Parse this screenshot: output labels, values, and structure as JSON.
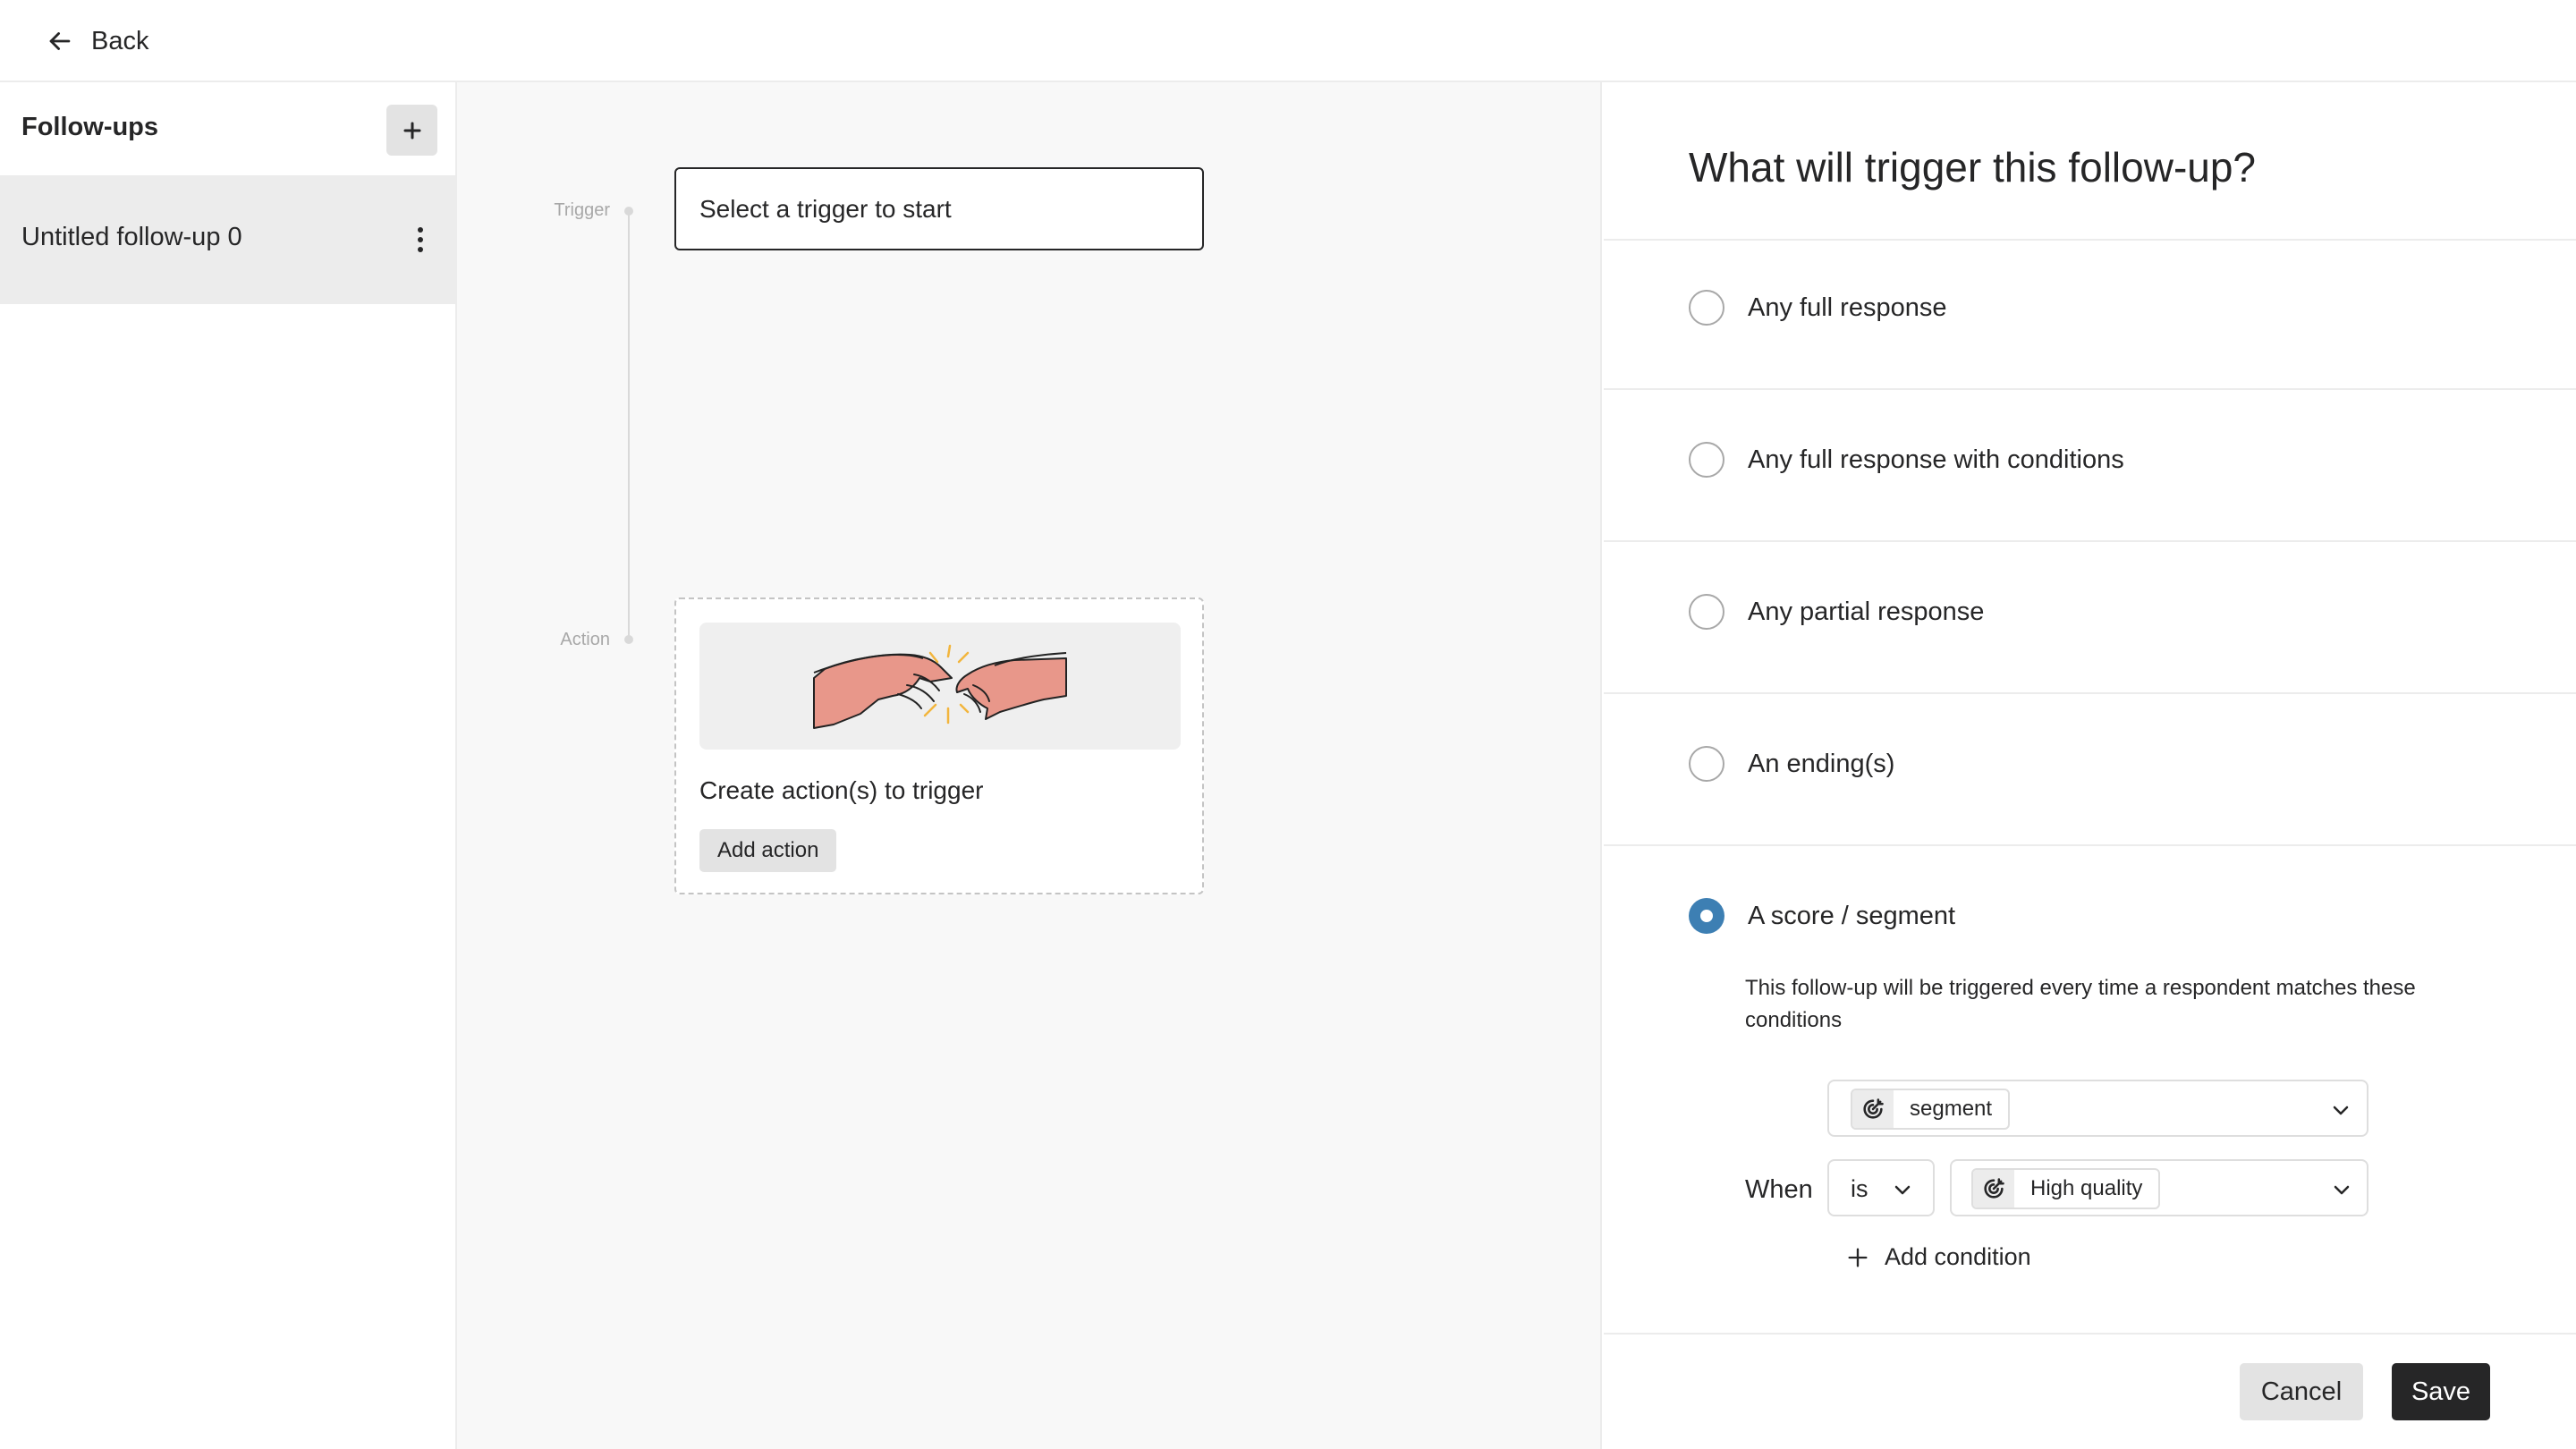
{
  "header": {
    "back_label": "Back"
  },
  "sidebar": {
    "title": "Follow-ups",
    "items": [
      {
        "label": "Untitled follow-up 0"
      }
    ]
  },
  "canvas": {
    "trigger_label": "Trigger",
    "action_label": "Action",
    "trigger_placeholder": "Select a trigger to start",
    "action_title": "Create action(s) to trigger",
    "add_action_label": "Add action"
  },
  "panel": {
    "title": "What will trigger this follow-up?",
    "options": [
      {
        "label": "Any full response",
        "selected": false
      },
      {
        "label": "Any full response with conditions",
        "selected": false
      },
      {
        "label": "Any partial response",
        "selected": false
      },
      {
        "label": "An ending(s)",
        "selected": false
      },
      {
        "label": "A score / segment",
        "selected": true
      }
    ],
    "segment": {
      "description": "This follow-up will be triggered every time a respondent matches these conditions",
      "when_label": "When",
      "field_value": "segment",
      "operator_value": "is",
      "condition_value": "High quality",
      "add_condition_label": "Add condition"
    }
  },
  "footer": {
    "cancel_label": "Cancel",
    "save_label": "Save"
  },
  "colors": {
    "accent": "#3d7fb3",
    "dark": "#262627",
    "canvas_bg": "#f8f8f8",
    "selected_item_bg": "#ececec"
  },
  "icons": {
    "back": "arrow-left-icon",
    "add": "plus-icon",
    "more": "kebab-icon",
    "segment": "target-icon",
    "dropdown": "chevron-down-icon"
  }
}
